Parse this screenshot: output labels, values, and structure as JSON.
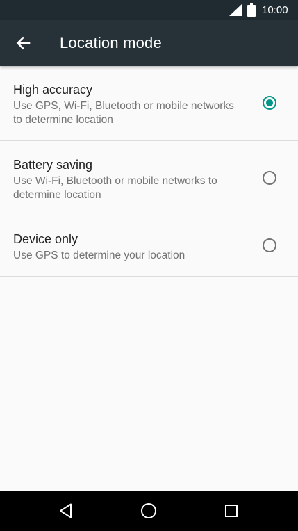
{
  "status_bar": {
    "time": "10:00",
    "icons": [
      "cell-signal-icon",
      "battery-icon"
    ]
  },
  "app_bar": {
    "title": "Location mode",
    "back_icon": "arrow-left-icon"
  },
  "options": [
    {
      "label": "High accuracy",
      "summary": "Use GPS, Wi-Fi, Bluetooth or mobile networks to determine location",
      "selected": true
    },
    {
      "label": "Battery saving",
      "summary": "Use Wi-Fi, Bluetooth or mobile networks to determine location",
      "selected": false
    },
    {
      "label": "Device only",
      "summary": "Use GPS to determine your location",
      "selected": false
    }
  ],
  "nav_bar": {
    "buttons": [
      "back-triangle-icon",
      "home-circle-icon",
      "recents-square-icon"
    ]
  },
  "colors": {
    "accent": "#009688",
    "toolbar": "#263238",
    "status_bar": "#1f2b31",
    "background": "#fafafa"
  }
}
